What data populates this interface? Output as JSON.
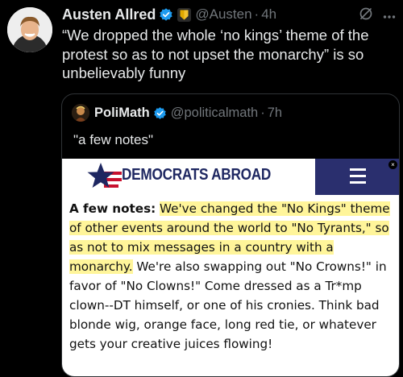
{
  "tweet": {
    "author_name": "Austen Allred",
    "handle": "@Austen",
    "separator": "·",
    "time": "4h",
    "text": "“We dropped the whole ‘no kings’ theme of the protest so as to not upset the monarchy” is so unbelievably funny"
  },
  "quote": {
    "author_name": "PoliMath",
    "handle": "@politicalmath",
    "separator": "·",
    "time": "7h",
    "text": "\"a few notes\"",
    "image": {
      "brand": "DEMOCRATS ABROAD",
      "lead_label": "A few notes:",
      "highlighted": "We've changed the \"No Kings\" theme of other events around the world to \"No Tyrants,\" so as not to mix messages in a country with a monarchy.",
      "rest": " We're also swapping out \"No Crowns!\" in favor of \"No Clowns!\" Come dressed as a Tr*mp clown--DT himself, or one of his cronies. Think bad blonde wig, orange face, long red tie, or whatever gets your creative juices flowing!",
      "close_glyph": "×"
    }
  },
  "colors": {
    "background": "#000000",
    "text": "#e7e9ea",
    "muted": "#71767b",
    "verified": "#1d9bf0",
    "highlight": "#fff59a",
    "brand_navy": "#1e2761",
    "brand_red": "#c8102e"
  },
  "icons": {
    "verified": "verified-badge-icon",
    "affiliate": "affiliate-badge-icon",
    "grok": "grok-icon",
    "more": "more-icon",
    "menu": "hamburger-menu-icon",
    "star": "star-logo-icon"
  }
}
